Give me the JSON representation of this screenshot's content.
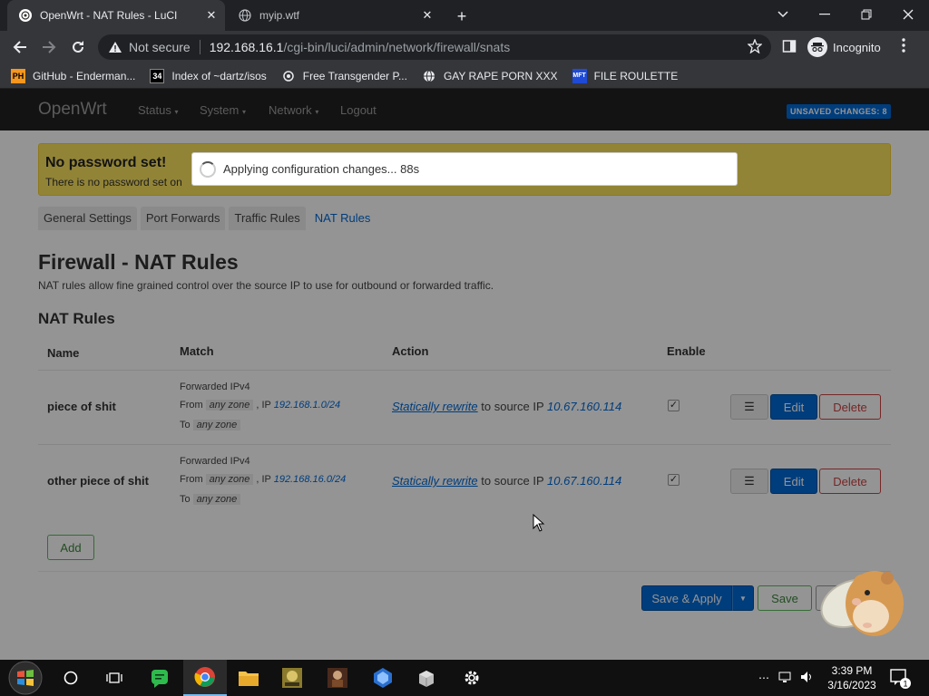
{
  "browser": {
    "tabs": [
      {
        "title": "OpenWrt - NAT Rules - LuCI",
        "active": true
      },
      {
        "title": "myip.wtf",
        "active": false
      }
    ],
    "security_label": "Not secure",
    "url_host": "192.168.16.1",
    "url_path": "/cgi-bin/luci/admin/network/firewall/snats",
    "profile_label": "Incognito",
    "bookmarks": [
      {
        "label": "GitHub - Enderman...",
        "icon": "PH"
      },
      {
        "label": "Index of ~dartz/isos",
        "icon": "34"
      },
      {
        "label": "Free Transgender P...",
        "icon": "gear-like"
      },
      {
        "label": "GAY RAPE PORN XXX",
        "icon": "globe"
      },
      {
        "label": "FILE ROULETTE",
        "icon": "MFT"
      }
    ]
  },
  "luci": {
    "brand": "OpenWrt",
    "nav": [
      "Status",
      "System",
      "Network",
      "Logout"
    ],
    "unsaved_badge": "UNSAVED CHANGES: 8",
    "alert_title": "No password set!",
    "alert_text": "There is no password set on",
    "modal_text": "Applying configuration changes... 88s",
    "tabs": [
      "General Settings",
      "Port Forwards",
      "Traffic Rules",
      "NAT Rules"
    ],
    "page_title": "Firewall - NAT Rules",
    "page_desc": "NAT rules allow fine grained control over the source IP to use for outbound or forwarded traffic.",
    "section_title": "NAT Rules",
    "columns": {
      "name": "Name",
      "match": "Match",
      "action": "Action",
      "enable": "Enable"
    },
    "rules": [
      {
        "name": "piece of shit",
        "family": "Forwarded IPv4",
        "from_label": "From",
        "from_zone": "any zone",
        "ip_label": ", IP",
        "ip": "192.168.1.0/24",
        "to_label": "To",
        "to_zone": "any zone",
        "action_link": "Statically rewrite",
        "action_mid": "to source IP",
        "action_ip": "10.67.160.114",
        "enabled": true
      },
      {
        "name": "other piece of shit",
        "family": "Forwarded IPv4",
        "from_label": "From",
        "from_zone": "any zone",
        "ip_label": ", IP",
        "ip": "192.168.16.0/24",
        "to_label": "To",
        "to_zone": "any zone",
        "action_link": "Statically rewrite",
        "action_mid": "to source IP",
        "action_ip": "10.67.160.114",
        "enabled": true
      }
    ],
    "row_buttons": {
      "drag": "☰",
      "edit": "Edit",
      "delete": "Delete"
    },
    "add_label": "Add",
    "save_apply_label": "Save & Apply",
    "save_label": "Save"
  },
  "taskbar": {
    "time": "3:39 PM",
    "date": "3/16/2023",
    "notification_count": "1"
  }
}
